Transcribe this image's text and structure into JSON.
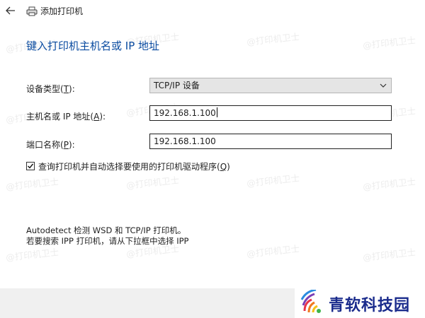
{
  "window": {
    "title": "添加打印机"
  },
  "heading": "键入打印机主机名或 IP 地址",
  "form": {
    "device_type": {
      "label_prefix": "设备类型(",
      "label_key": "T",
      "label_suffix": "):",
      "value": "TCP/IP 设备"
    },
    "hostname": {
      "label_prefix": "主机名或 IP 地址(",
      "label_key": "A",
      "label_suffix": "):",
      "value": "192.168.1.100"
    },
    "port": {
      "label_prefix": "端口名称(",
      "label_key": "P",
      "label_suffix": "):",
      "value": "192.168.1.100"
    },
    "auto_driver": {
      "checked": true,
      "label_prefix": "查询打印机并自动选择要使用的打印机驱动程序(",
      "label_key": "Q",
      "label_suffix": ")"
    }
  },
  "info": {
    "line1": "Autodetect 检测 WSD 和 TCP/IP 打印机。",
    "line2": "若要搜索 IPP 打印机，请从下拉框中选择 IPP"
  },
  "watermark": "@打印机卫士",
  "brand": {
    "name": "青软科技园"
  },
  "icons": [
    "back-arrow-icon",
    "printer-icon",
    "chevron-down-icon",
    "checkmark-icon",
    "brand-logo-icon"
  ],
  "colors": {
    "heading": "#0a4ba0",
    "dropdown_bg": "#e5e5e5",
    "bottom_bar": "#f0f0f0",
    "brand_text": "#1a2b8c"
  }
}
